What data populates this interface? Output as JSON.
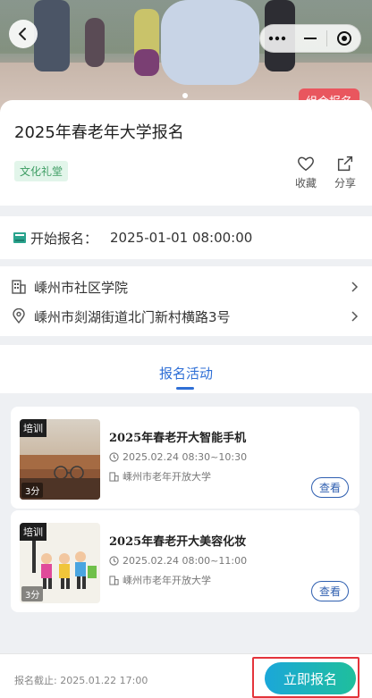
{
  "hero": {
    "group_badge": "组合报名"
  },
  "event": {
    "title": "2025年春老年大学报名",
    "tag": "文化礼堂",
    "favorite_label": "收藏",
    "share_label": "分享"
  },
  "schedule": {
    "start_label": "开始报名：",
    "start_value": "2025-01-01 08:00:00"
  },
  "location": {
    "institution": "嵊州市社区学院",
    "address": "嵊州市剡湖街道北门新村横路3号"
  },
  "tabs": {
    "active": "报名活动"
  },
  "activities": [
    {
      "badge": "培训",
      "minutes": "3分",
      "title": "2025年春老开大智能手机",
      "time": "2025.02.24 08:30~10:30",
      "place": "嵊州市老年开放大学",
      "view_label": "查看"
    },
    {
      "badge": "培训",
      "minutes": "3分",
      "title": "2025年春老开大美容化妆",
      "time": "2025.02.24 08:00~11:00",
      "place": "嵊州市老年开放大学",
      "view_label": "查看"
    }
  ],
  "footer": {
    "deadline": "报名截止: 2025.01.22 17:00",
    "signup_label": "立即报名"
  },
  "colors": {
    "accent_blue": "#2f6fd6",
    "badge_red": "#e9565e",
    "tag_green": "#3c9c62",
    "cta_start": "#1ba7d9",
    "cta_end": "#1fbf9c"
  }
}
